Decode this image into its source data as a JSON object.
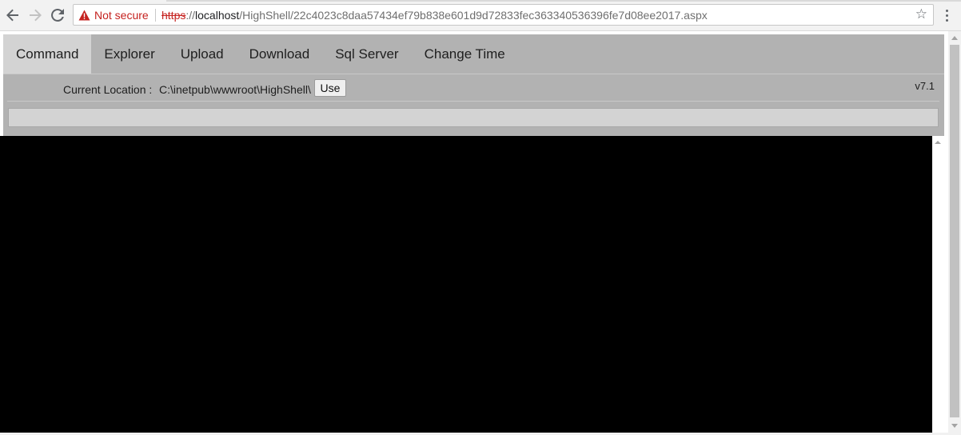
{
  "browser": {
    "security_label": "Not secure",
    "url_scheme": "https",
    "url_separator": "://",
    "url_host": "localhost",
    "url_path": "/HighShell/22c4023c8daa57434ef79b838e601d9d72833fec363340536396fe7d08ee2017.aspx",
    "icons": {
      "back": "back-arrow-icon",
      "forward": "forward-arrow-icon",
      "reload": "reload-icon",
      "security": "warning-triangle-icon",
      "bookmark": "star-icon",
      "menu": "kebab-menu-icon"
    },
    "colors": {
      "insecure": "#c5221f"
    }
  },
  "shell": {
    "tabs": [
      {
        "label": "Command",
        "active": true
      },
      {
        "label": "Explorer",
        "active": false
      },
      {
        "label": "Upload",
        "active": false
      },
      {
        "label": "Download",
        "active": false
      },
      {
        "label": "Sql Server",
        "active": false
      },
      {
        "label": "Change Time",
        "active": false
      }
    ],
    "location_label": "Current Location :",
    "location_path": "C:\\inetpub\\wwwroot\\HighShell\\",
    "use_label": "Use",
    "version": "v7.1",
    "command_value": "",
    "console_output": "",
    "colors": {
      "header_bg": "#b2b2b2",
      "active_tab_bg": "#d3d3d3",
      "console_bg": "#000000"
    }
  }
}
